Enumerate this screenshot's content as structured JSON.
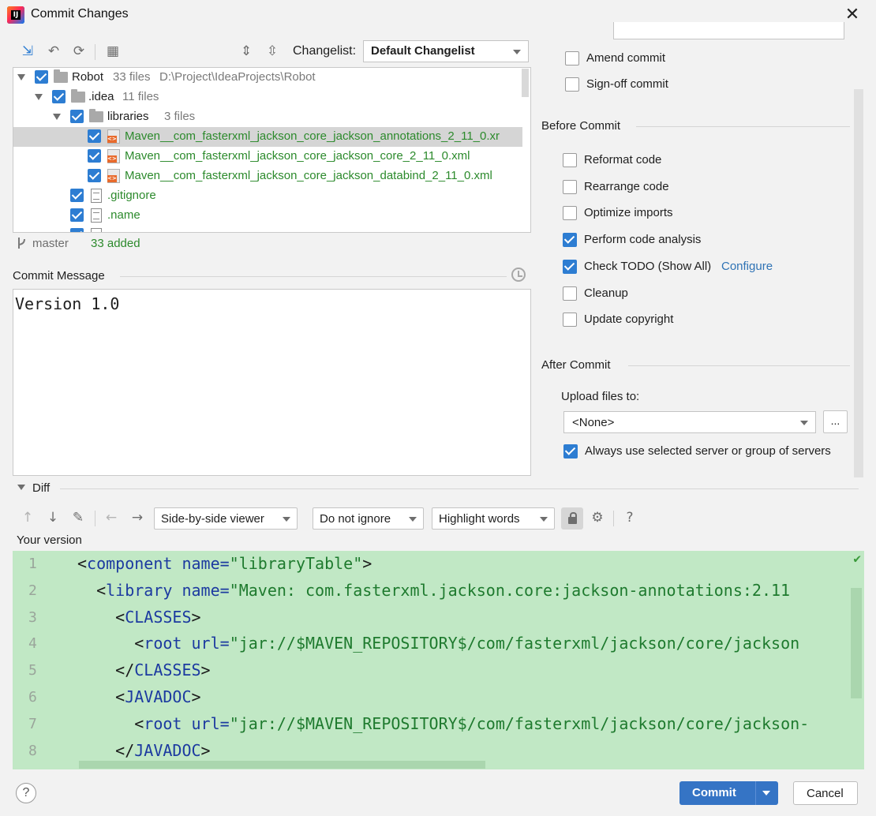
{
  "window": {
    "title": "Commit Changes",
    "close_glyph": "✕"
  },
  "toolbar": {
    "icons": [
      "show-diff-icon",
      "rollback-icon",
      "refresh-icon",
      "group-by-icon",
      "expand-all-icon",
      "collapse-all-icon"
    ],
    "changelist_label": "Changelist:",
    "changelist_value": "Default Changelist"
  },
  "tree": {
    "root": {
      "name": "Robot",
      "count": "33 files",
      "path": "D:\\Project\\IdeaProjects\\Robot"
    },
    "idea": {
      "name": ".idea",
      "count": "11 files"
    },
    "libraries": {
      "name": "libraries",
      "count": "3 files"
    },
    "files": [
      "Maven__com_fasterxml_jackson_core_jackson_annotations_2_11_0.xr",
      "Maven__com_fasterxml_jackson_core_jackson_core_2_11_0.xml",
      "Maven__com_fasterxml_jackson_core_jackson_databind_2_11_0.xml"
    ],
    "gitignore": ".gitignore",
    "name_file": ".name",
    "partial": "    "
  },
  "status": {
    "branch": "master",
    "added": "33 added"
  },
  "commit_message": {
    "label": "Commit Message",
    "text": "Version 1.0"
  },
  "options": {
    "amend": "Amend commit",
    "signoff": "Sign-off commit",
    "before_commit": "Before Commit",
    "reformat": "Reformat code",
    "rearrange": "Rearrange code",
    "optimize": "Optimize imports",
    "analysis": "Perform code analysis",
    "todo": "Check TODO (Show All)",
    "configure": "Configure",
    "cleanup": "Cleanup",
    "copyright": "Update copyright",
    "after_commit": "After Commit",
    "upload_label": "Upload files to:",
    "upload_value": "<None>",
    "upload_more": "...",
    "always_use": "Always use selected server or group of servers"
  },
  "diff": {
    "label": "Diff",
    "viewer": "Side-by-side viewer",
    "ignore": "Do not ignore",
    "highlight": "Highlight words",
    "help": "?",
    "your_version": "Your version",
    "check": "✔",
    "line_numbers": [
      "1",
      "2",
      "3",
      "4",
      "5",
      "6",
      "7",
      "8"
    ],
    "lines": [
      {
        "indent": "",
        "open": "<",
        "tag": "component",
        "attr": " name=",
        "val": "\"libraryTable\"",
        "close": ">"
      },
      {
        "indent": "  ",
        "open": "<",
        "tag": "library",
        "attr": " name=",
        "val": "\"Maven: com.fasterxml.jackson.core:jackson-annotations:2.11",
        "close": ""
      },
      {
        "indent": "    ",
        "open": "<",
        "tag": "CLASSES",
        "attr": "",
        "val": "",
        "close": ">"
      },
      {
        "indent": "      ",
        "open": "<",
        "tag": "root",
        "attr": " url=",
        "val": "\"jar://$MAVEN_REPOSITORY$/com/fasterxml/jackson/core/jackson",
        "close": ""
      },
      {
        "indent": "    ",
        "open": "</",
        "tag": "CLASSES",
        "attr": "",
        "val": "",
        "close": ">"
      },
      {
        "indent": "    ",
        "open": "<",
        "tag": "JAVADOC",
        "attr": "",
        "val": "",
        "close": ">"
      },
      {
        "indent": "      ",
        "open": "<",
        "tag": "root",
        "attr": " url=",
        "val": "\"jar://$MAVEN_REPOSITORY$/com/fasterxml/jackson/core/jackson-",
        "close": ""
      },
      {
        "indent": "    ",
        "open": "</",
        "tag": "JAVADOC",
        "attr": "",
        "val": "",
        "close": ">"
      }
    ]
  },
  "footer": {
    "help": "?",
    "commit": "Commit",
    "cancel": "Cancel"
  },
  "colors": {
    "accent": "#3574c5",
    "checkbox": "#2d7dd2",
    "added_file": "#2c8a2c",
    "diff_bg": "#c1e8c5"
  }
}
